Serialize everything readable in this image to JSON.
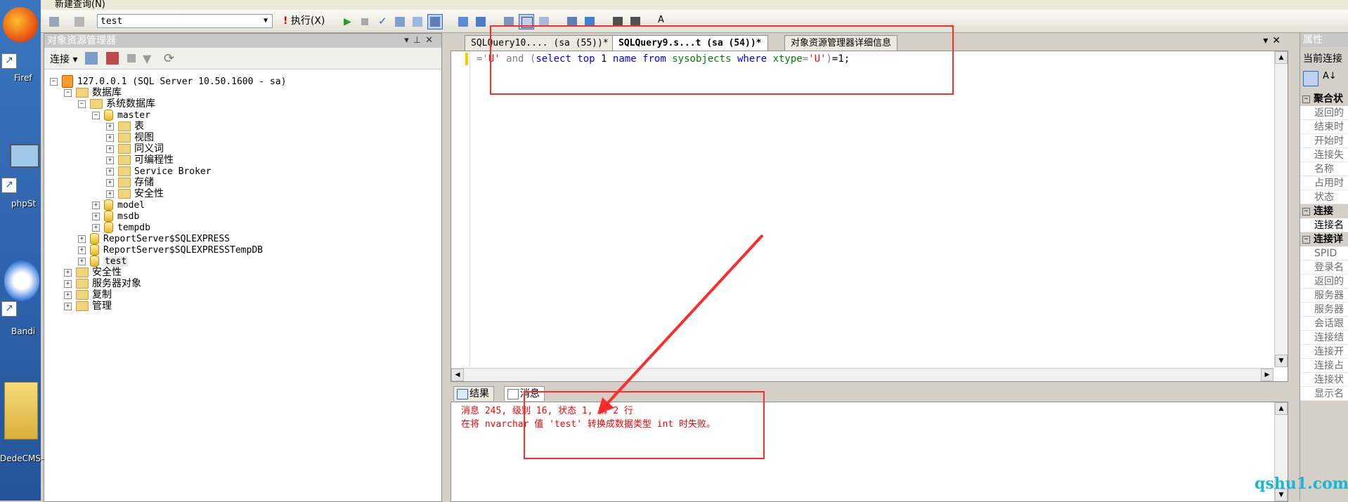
{
  "desktop": {
    "icons": [
      {
        "label": "Firef"
      },
      {
        "label": "phpSt"
      },
      {
        "label": "Bandi"
      },
      {
        "label": "DedeCMS-V"
      }
    ]
  },
  "menubar": {
    "label": "新建查询(N)"
  },
  "toolbar": {
    "database": "test",
    "execute_label": "执行(X)"
  },
  "object_explorer": {
    "title": "对象资源管理器",
    "connect_label": "连接",
    "server": "127.0.0.1 (SQL Server 10.50.1600 - sa)",
    "databases": "数据库",
    "system_databases": "系统数据库",
    "master": "master",
    "master_children": [
      "表",
      "视图",
      "同义词",
      "可编程性",
      "Service Broker",
      "存储",
      "安全性"
    ],
    "model": "model",
    "msdb": "msdb",
    "tempdb": "tempdb",
    "report_server": "ReportServer$SQLEXPRESS",
    "report_server_temp": "ReportServer$SQLEXPRESSTempDB",
    "test_db": "test",
    "security": "安全性",
    "server_objects": "服务器对象",
    "replication": "复制",
    "management": "管理"
  },
  "tabs": [
    {
      "label": "SQLQuery10.... (sa (55))*"
    },
    {
      "label": "SQLQuery9.s...t (sa (54))*"
    },
    {
      "label": "对象资源管理器详细信息"
    }
  ],
  "editor": {
    "code": {
      "t1": "='",
      "t2": "U'",
      "t3": " and ",
      "t4": "(",
      "t5": "select",
      "t6": " ",
      "t7": "top",
      "t8": " 1 ",
      "t9": "name",
      "t10": " ",
      "t11": "from",
      "t12": " ",
      "t13": "sysobjects",
      "t14": " ",
      "t15": "where",
      "t16": " ",
      "t17": "xtype",
      "t18": "=",
      "t19": "'U'",
      "t20": ")",
      "t21": "=1;"
    }
  },
  "results": {
    "tabs": [
      "结果",
      "消息"
    ],
    "message_line1": "消息 245, 级别 16, 状态 1, 第 2 行",
    "message_line2": "在将 nvarchar 值 'test' 转换成数据类型 int 时失败。"
  },
  "properties": {
    "title": "属性",
    "current": "当前连接",
    "rows": [
      {
        "type": "cat",
        "label": "聚合状"
      },
      {
        "type": "item",
        "label": "返回的"
      },
      {
        "type": "item",
        "label": "结束时"
      },
      {
        "type": "item",
        "label": "开始时"
      },
      {
        "type": "item",
        "label": "连接失"
      },
      {
        "type": "item",
        "label": "名称"
      },
      {
        "type": "item",
        "label": "占用时"
      },
      {
        "type": "item",
        "label": "状态"
      },
      {
        "type": "cat",
        "label": "连接"
      },
      {
        "type": "item",
        "label": "连接名"
      },
      {
        "type": "cat",
        "label": "连接详"
      },
      {
        "type": "item",
        "label": "SPID"
      },
      {
        "type": "item",
        "label": "登录名"
      },
      {
        "type": "item",
        "label": "返回的"
      },
      {
        "type": "item",
        "label": "服务器"
      },
      {
        "type": "item",
        "label": "服务器"
      },
      {
        "type": "item",
        "label": "会话跟"
      },
      {
        "type": "item",
        "label": "连接结"
      },
      {
        "type": "item",
        "label": "连接开"
      },
      {
        "type": "item",
        "label": "连接占"
      },
      {
        "type": "item",
        "label": "连接状"
      },
      {
        "type": "item",
        "label": "显示名"
      }
    ]
  },
  "watermark": "qshu1.com",
  "annotation_color": "#ff2b2b"
}
